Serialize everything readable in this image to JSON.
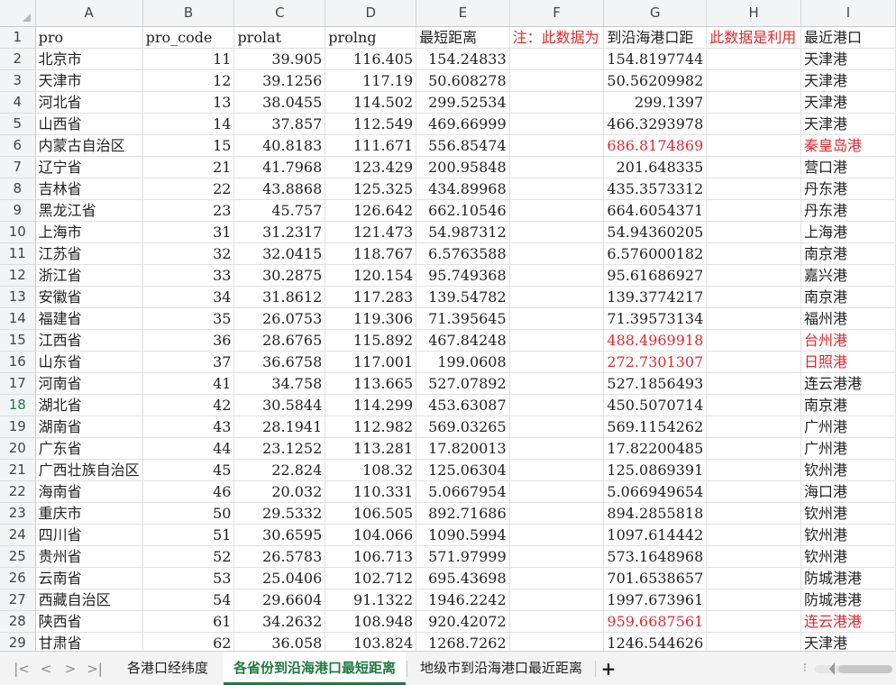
{
  "columns": [
    "A",
    "B",
    "C",
    "D",
    "E",
    "F",
    "G",
    "H",
    "I"
  ],
  "row_numbers": [
    "1",
    "2",
    "3",
    "4",
    "5",
    "6",
    "7",
    "8",
    "9",
    "10",
    "11",
    "12",
    "13",
    "14",
    "15",
    "16",
    "17",
    "18",
    "19",
    "20",
    "21",
    "22",
    "23",
    "24",
    "25",
    "26",
    "27",
    "28",
    "29"
  ],
  "header": {
    "A": "pro",
    "B": "pro_code",
    "C": "prolat",
    "D": "prolng",
    "E": "最短距离",
    "F": "注：此数据为",
    "G": "到沿海港口距",
    "H": "此数据是利用",
    "I": "最近港口"
  },
  "rows": [
    {
      "A": "北京市",
      "B": "11",
      "C": "39.905",
      "D": "116.405",
      "E": "154.24833",
      "G": "154.8197744",
      "I": "天津港",
      "red": false
    },
    {
      "A": "天津市",
      "B": "12",
      "C": "39.1256",
      "D": "117.19",
      "E": "50.608278",
      "G": "50.56209982",
      "I": "天津港",
      "red": false
    },
    {
      "A": "河北省",
      "B": "13",
      "C": "38.0455",
      "D": "114.502",
      "E": "299.52534",
      "G": "299.1397",
      "I": "天津港",
      "red": false
    },
    {
      "A": "山西省",
      "B": "14",
      "C": "37.857",
      "D": "112.549",
      "E": "469.66999",
      "G": "466.3293978",
      "I": "天津港",
      "red": false
    },
    {
      "A": "内蒙古自治区",
      "B": "15",
      "C": "40.8183",
      "D": "111.671",
      "E": "556.85474",
      "G": "686.8174869",
      "I": "秦皇岛港",
      "red": true
    },
    {
      "A": "辽宁省",
      "B": "21",
      "C": "41.7968",
      "D": "123.429",
      "E": "200.95848",
      "G": "201.648335",
      "I": "营口港",
      "red": false
    },
    {
      "A": "吉林省",
      "B": "22",
      "C": "43.8868",
      "D": "125.325",
      "E": "434.89968",
      "G": "435.3573312",
      "I": "丹东港",
      "red": false
    },
    {
      "A": "黑龙江省",
      "B": "23",
      "C": "45.757",
      "D": "126.642",
      "E": "662.10546",
      "G": "664.6054371",
      "I": "丹东港",
      "red": false
    },
    {
      "A": "上海市",
      "B": "31",
      "C": "31.2317",
      "D": "121.473",
      "E": "54.987312",
      "G": "54.94360205",
      "I": "上海港",
      "red": false
    },
    {
      "A": "江苏省",
      "B": "32",
      "C": "32.0415",
      "D": "118.767",
      "E": "6.5763588",
      "G": "6.576000182",
      "I": "南京港",
      "red": false
    },
    {
      "A": "浙江省",
      "B": "33",
      "C": "30.2875",
      "D": "120.154",
      "E": "95.749368",
      "G": "95.61686927",
      "I": "嘉兴港",
      "red": false
    },
    {
      "A": "安徽省",
      "B": "34",
      "C": "31.8612",
      "D": "117.283",
      "E": "139.54782",
      "G": "139.3774217",
      "I": "南京港",
      "red": false
    },
    {
      "A": "福建省",
      "B": "35",
      "C": "26.0753",
      "D": "119.306",
      "E": "71.395645",
      "G": "71.39573134",
      "I": "福州港",
      "red": false
    },
    {
      "A": "江西省",
      "B": "36",
      "C": "28.6765",
      "D": "115.892",
      "E": "467.84248",
      "G": "488.4969918",
      "I": "台州港",
      "red": true
    },
    {
      "A": "山东省",
      "B": "37",
      "C": "36.6758",
      "D": "117.001",
      "E": "199.0608",
      "G": "272.7301307",
      "I": "日照港",
      "red": true
    },
    {
      "A": "河南省",
      "B": "41",
      "C": "34.758",
      "D": "113.665",
      "E": "527.07892",
      "G": "527.1856493",
      "I": "连云港港",
      "red": false
    },
    {
      "A": "湖北省",
      "B": "42",
      "C": "30.5844",
      "D": "114.299",
      "E": "453.63087",
      "G": "450.5070714",
      "I": "南京港",
      "red": false
    },
    {
      "A": "湖南省",
      "B": "43",
      "C": "28.1941",
      "D": "112.982",
      "E": "569.03265",
      "G": "569.1154262",
      "I": "广州港",
      "red": false
    },
    {
      "A": "广东省",
      "B": "44",
      "C": "23.1252",
      "D": "113.281",
      "E": "17.820013",
      "G": "17.82200485",
      "I": "广州港",
      "red": false
    },
    {
      "A": "广西壮族自治区",
      "B": "45",
      "C": "22.824",
      "D": "108.32",
      "E": "125.06304",
      "G": "125.0869391",
      "I": "钦州港",
      "red": false
    },
    {
      "A": "海南省",
      "B": "46",
      "C": "20.032",
      "D": "110.331",
      "E": "5.0667954",
      "G": "5.066949654",
      "I": "海口港",
      "red": false
    },
    {
      "A": "重庆市",
      "B": "50",
      "C": "29.5332",
      "D": "106.505",
      "E": "892.71686",
      "G": "894.2855818",
      "I": "钦州港",
      "red": false
    },
    {
      "A": "四川省",
      "B": "51",
      "C": "30.6595",
      "D": "104.066",
      "E": "1090.5994",
      "G": "1097.614442",
      "I": "钦州港",
      "red": false
    },
    {
      "A": "贵州省",
      "B": "52",
      "C": "26.5783",
      "D": "106.713",
      "E": "571.97999",
      "G": "573.1648968",
      "I": "钦州港",
      "red": false
    },
    {
      "A": "云南省",
      "B": "53",
      "C": "25.0406",
      "D": "102.712",
      "E": "695.43698",
      "G": "701.6538657",
      "I": "防城港港",
      "red": false
    },
    {
      "A": "西藏自治区",
      "B": "54",
      "C": "29.6604",
      "D": "91.1322",
      "E": "1946.2242",
      "G": "1997.673961",
      "I": "防城港港",
      "red": false
    },
    {
      "A": "陕西省",
      "B": "61",
      "C": "34.2632",
      "D": "108.948",
      "E": "920.42072",
      "G": "959.6687561",
      "I": "连云港港",
      "red": true
    },
    {
      "A": "甘肃省",
      "B": "62",
      "C": "36.058",
      "D": "103.824",
      "E": "1268.7262",
      "G": "1246.544626",
      "I": "天津港",
      "red": false
    }
  ],
  "selected_row": "18",
  "sheet_tabs": [
    "各港口经纬度",
    "各省份到沿海港口最短距离",
    "地级市到沿海港口最近距离"
  ],
  "active_tab": "各省份到沿海港口最短距离",
  "nav_icons": [
    "first-sheet-icon",
    "prev-sheet-icon",
    "next-sheet-icon",
    "last-sheet-icon"
  ],
  "nav_glyphs": {
    "first": "|<",
    "prev": "<",
    "next": ">",
    "last": ">|"
  },
  "add_sheet_glyph": "+",
  "colors": {
    "accent": "#1f7a3f",
    "red_text": "#e8262c",
    "header_bg": "#f3f4f6",
    "grid": "#e1e1e1"
  }
}
